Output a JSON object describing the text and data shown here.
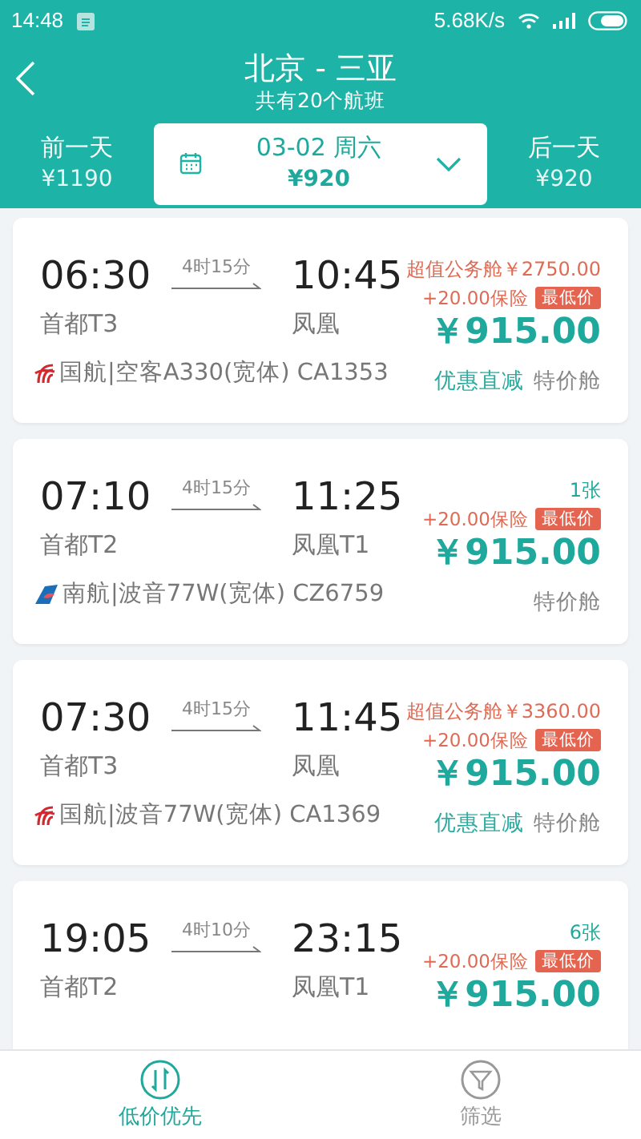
{
  "status_bar": {
    "time": "14:48",
    "speed": "5.68K/s"
  },
  "header": {
    "title": "北京 - 三亚",
    "subtitle": "共有20个航班"
  },
  "date_bar": {
    "prev": {
      "label": "前一天",
      "price": "¥1190"
    },
    "current": {
      "date": "03-02 周六",
      "price": "¥920"
    },
    "next": {
      "label": "后一天",
      "price": "¥920"
    }
  },
  "flights": [
    {
      "depart_time": "06:30",
      "duration": "4时15分",
      "arrive_time": "10:45",
      "depart_airport": "首都T3",
      "arrive_airport": "凤凰",
      "note": {
        "kind": "offer",
        "text": "超值公务舱￥2750.00"
      },
      "insurance": "+20.00保险",
      "badge": "最低价",
      "price": "￥915.00",
      "airline": {
        "kind": "ca",
        "text": "国航|空客A330(宽体) CA1353"
      },
      "tags": [
        {
          "kind": "promo",
          "text": "优惠直减"
        },
        {
          "kind": "plain",
          "text": "特价舱"
        }
      ]
    },
    {
      "depart_time": "07:10",
      "duration": "4时15分",
      "arrive_time": "11:25",
      "depart_airport": "首都T2",
      "arrive_airport": "凤凰T1",
      "note": {
        "kind": "seats",
        "text": "1张"
      },
      "insurance": "+20.00保险",
      "badge": "最低价",
      "price": "￥915.00",
      "airline": {
        "kind": "cz",
        "text": "南航|波音77W(宽体) CZ6759"
      },
      "tags": [
        {
          "kind": "plain",
          "text": "特价舱"
        }
      ]
    },
    {
      "depart_time": "07:30",
      "duration": "4时15分",
      "arrive_time": "11:45",
      "depart_airport": "首都T3",
      "arrive_airport": "凤凰",
      "note": {
        "kind": "offer",
        "text": "超值公务舱￥3360.00"
      },
      "insurance": "+20.00保险",
      "badge": "最低价",
      "price": "￥915.00",
      "airline": {
        "kind": "ca",
        "text": "国航|波音77W(宽体) CA1369"
      },
      "tags": [
        {
          "kind": "promo",
          "text": "优惠直减"
        },
        {
          "kind": "plain",
          "text": "特价舱"
        }
      ]
    },
    {
      "depart_time": "19:05",
      "duration": "4时10分",
      "arrive_time": "23:15",
      "depart_airport": "首都T2",
      "arrive_airport": "凤凰T1",
      "note": {
        "kind": "seats",
        "text": "6张"
      },
      "insurance": "+20.00保险",
      "badge": "最低价",
      "price": "￥915.00"
    }
  ],
  "bottom_bar": [
    {
      "kind": "sort",
      "label": "低价优先",
      "selected": true
    },
    {
      "kind": "filter",
      "label": "筛选",
      "selected": false
    }
  ]
}
